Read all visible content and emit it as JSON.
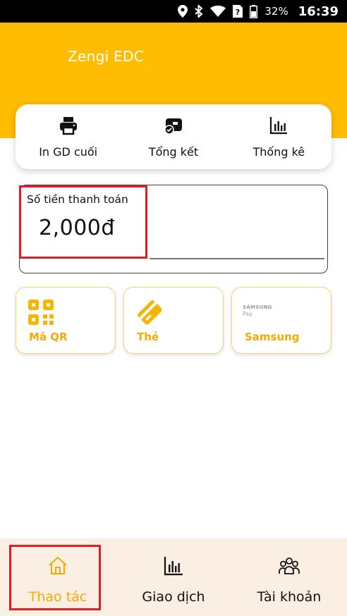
{
  "status_bar": {
    "battery": "32%",
    "time": "16:39"
  },
  "app": {
    "title": "Zengi EDC"
  },
  "quick_actions": [
    {
      "label": "In GD cuối",
      "icon": "printer-icon"
    },
    {
      "label": "Tổng kết",
      "icon": "summary-icon"
    },
    {
      "label": "Thống kê",
      "icon": "bar-chart-icon"
    }
  ],
  "amount": {
    "label": "Số tiền thanh toán",
    "value": "2,000đ"
  },
  "payment_methods": [
    {
      "label": "Mã QR",
      "icon": "qr-icon"
    },
    {
      "label": "Thẻ",
      "icon": "card-icon"
    },
    {
      "label": "Samsung",
      "icon": "samsung-pay-logo",
      "logo_line1": "SAMSUNG",
      "logo_line2": "Pay"
    }
  ],
  "bottom_nav": [
    {
      "label": "Thao tác",
      "icon": "home-icon",
      "active": true
    },
    {
      "label": "Giao dịch",
      "icon": "bar-chart-icon",
      "active": false
    },
    {
      "label": "Tài khoản",
      "icon": "users-icon",
      "active": false
    }
  ],
  "colors": {
    "primary": "#FFBC00",
    "accent": "#F7A900",
    "highlight": "#E31B23",
    "nav_bg": "#FBEEE3"
  }
}
